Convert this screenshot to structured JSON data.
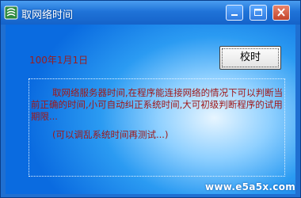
{
  "window": {
    "title": "取网络时间",
    "icon": "app-icon"
  },
  "title_buttons": {
    "minimize_icon": "minimize-icon",
    "maximize_icon": "maximize-icon",
    "close_icon": "close-icon"
  },
  "main": {
    "date_text": "100年1月1日",
    "calibrate_button": "校时",
    "description": "取网络服务器时间,在程序能连接网络的情况下可以判断当前正确的时间,小可自动纠正系统时间,大可初级判断程序的试用期限...",
    "note": "(可以调乱系统时间再测试...)"
  },
  "watermark": "www.e5a5x.com",
  "colors": {
    "window_blue": "#1f6fd1",
    "text_red": "#a01818",
    "date_red": "#9b1d1d"
  }
}
